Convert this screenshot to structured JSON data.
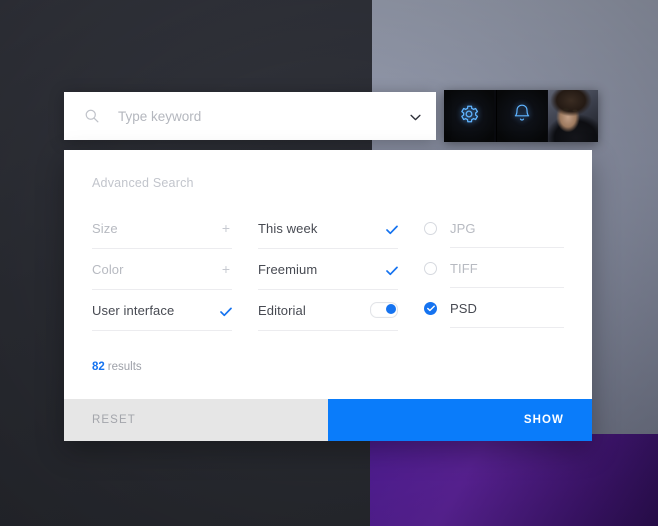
{
  "colors": {
    "accent": "#1573f0",
    "show_button": "#0a7cfa",
    "reset_button": "#e6e6e6",
    "panel_bg": "#ffffff",
    "bg_dark": "#2b2d35",
    "bg_grey": "#878da0",
    "bg_purple": "#5c2399",
    "muted_text": "#b7bac1",
    "dark_text": "#474a52"
  },
  "search": {
    "placeholder": "Type keyword",
    "value": "",
    "search_icon": "search-icon",
    "chevron_icon": "chevron-down-icon"
  },
  "toolbar": {
    "items": [
      {
        "name": "settings",
        "icon": "gear-icon"
      },
      {
        "name": "notifications",
        "icon": "bell-icon"
      },
      {
        "name": "profile",
        "icon": "avatar"
      }
    ]
  },
  "panel": {
    "title": "Advanced Search",
    "columns": [
      {
        "name": "attributes",
        "rows": [
          {
            "label": "Size",
            "control": "plus",
            "state": "collapsed"
          },
          {
            "label": "Color",
            "control": "plus",
            "state": "collapsed"
          },
          {
            "label": "User interface",
            "control": "check",
            "state": "selected"
          }
        ]
      },
      {
        "name": "filters",
        "rows": [
          {
            "label": "This week",
            "control": "check",
            "state": "selected"
          },
          {
            "label": "Freemium",
            "control": "check",
            "state": "selected"
          },
          {
            "label": "Editorial",
            "control": "toggle",
            "state": "on"
          }
        ]
      },
      {
        "name": "file-format",
        "rows": [
          {
            "label": "JPG",
            "control": "radio",
            "state": "off"
          },
          {
            "label": "TIFF",
            "control": "radio",
            "state": "off"
          },
          {
            "label": "PSD",
            "control": "radio",
            "state": "on"
          }
        ]
      }
    ],
    "results": {
      "count": "82",
      "label": "results"
    },
    "footer": {
      "reset_label": "RESET",
      "show_label": "SHOW"
    }
  }
}
